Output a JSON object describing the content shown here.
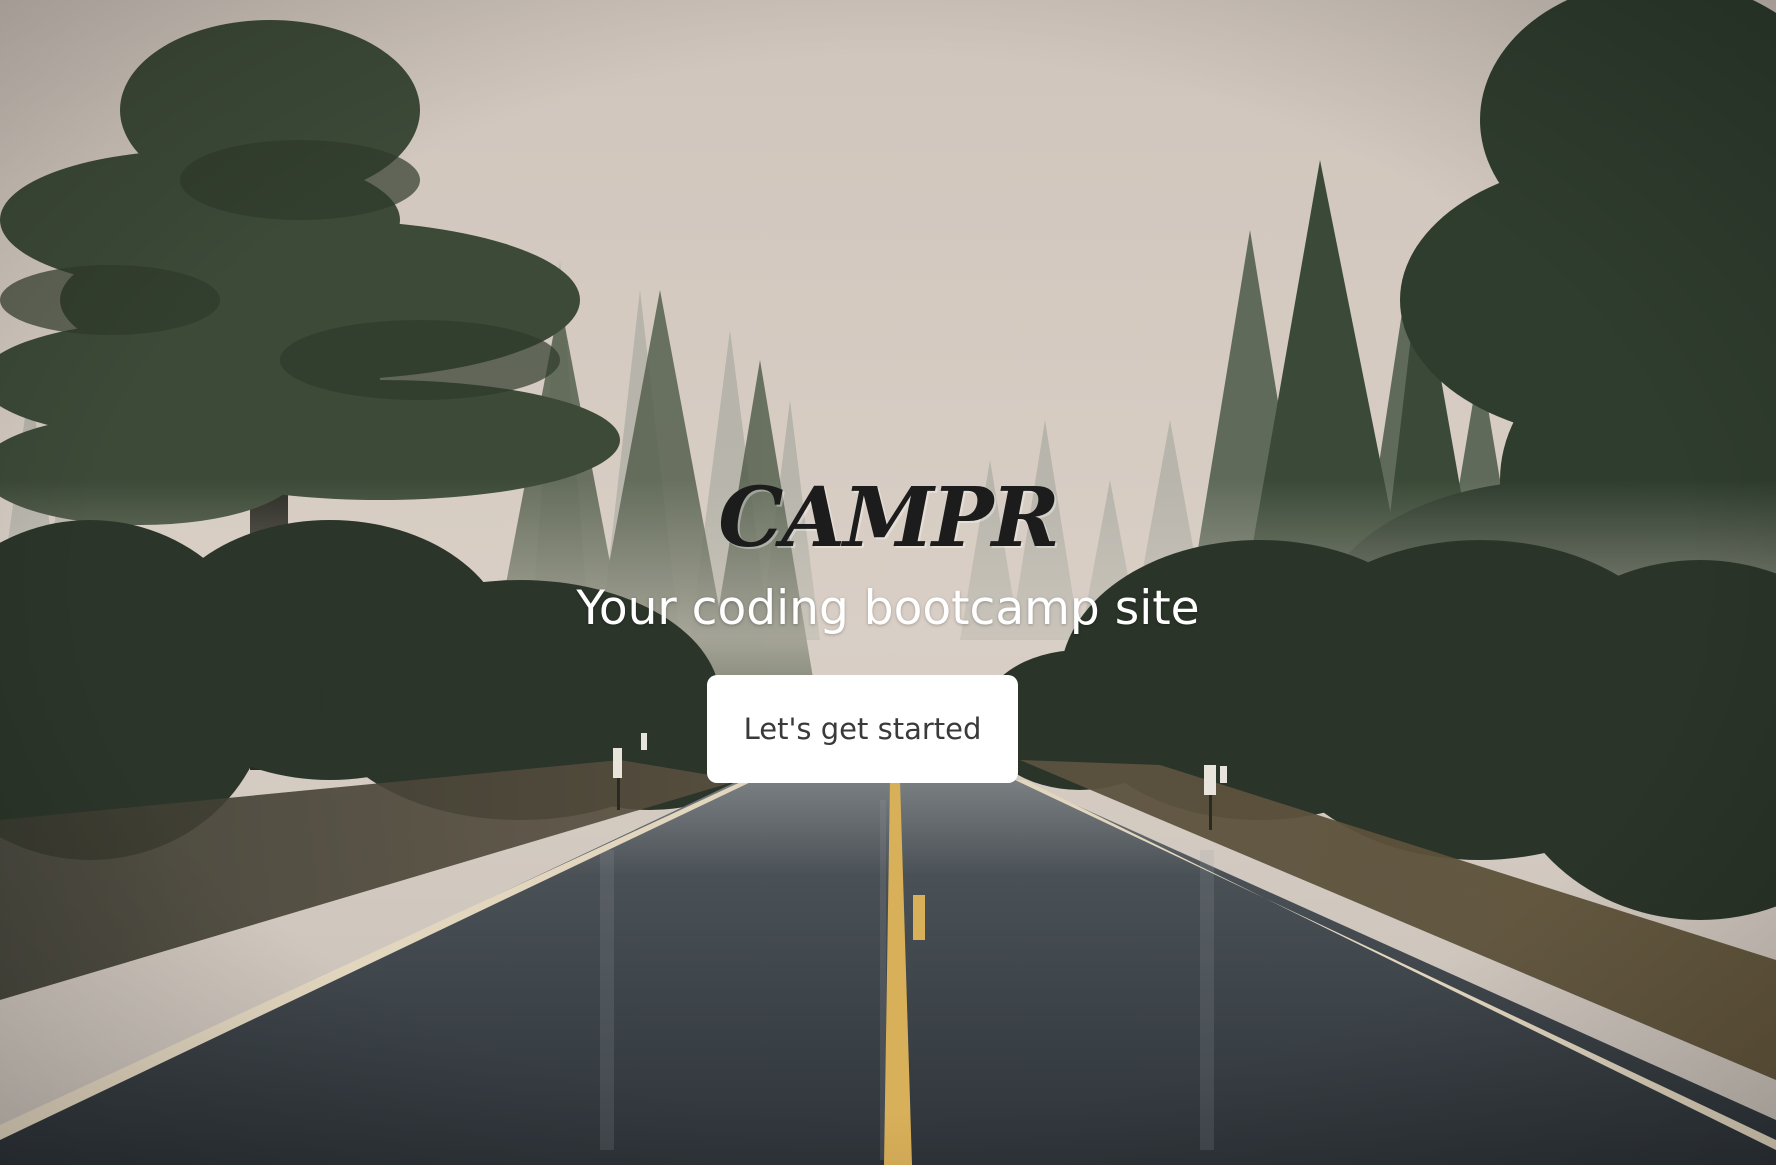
{
  "hero": {
    "brand": "CAMPR",
    "tagline": "Your coding bootcamp site",
    "cta_label": "Let's get started"
  },
  "colors": {
    "sky": "#d6cdc4",
    "forest": "#2f3a30",
    "road": "#3b4146",
    "center_line": "#d9b05a",
    "edge_line": "#e2d6bf",
    "button_bg": "#ffffff",
    "button_text": "#3a3a3a",
    "brand_text": "#1c1c1c",
    "tagline_text": "#ffffff"
  },
  "icons": {
    "background": "misty-forest-road-photo"
  }
}
